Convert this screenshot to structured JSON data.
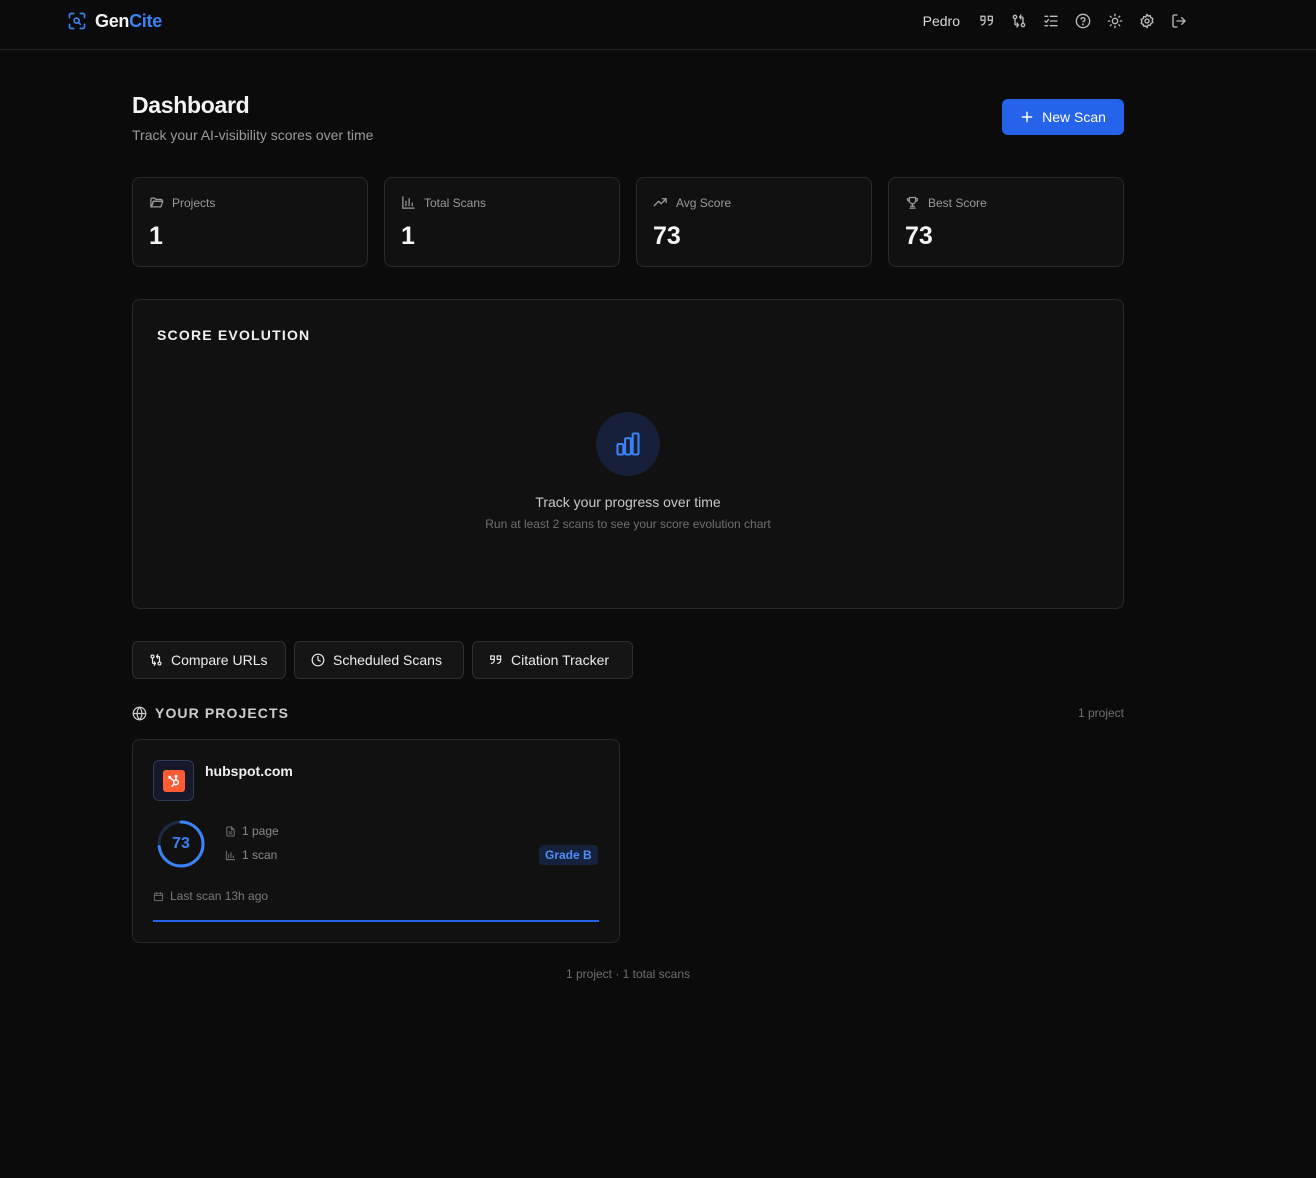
{
  "brand": {
    "part1": "Gen",
    "part2": "Cite"
  },
  "nav": {
    "user": "Pedro",
    "icons": [
      "quote-icon",
      "compare-icon",
      "checklist-icon",
      "help-icon",
      "sun-icon",
      "settings-icon",
      "logout-icon"
    ]
  },
  "header": {
    "title": "Dashboard",
    "subtitle": "Track your AI-visibility scores over time",
    "new_scan_label": "New Scan"
  },
  "stats": [
    {
      "label": "Projects",
      "value": "1",
      "icon": "folder-icon"
    },
    {
      "label": "Total Scans",
      "value": "1",
      "icon": "bar-chart-icon"
    },
    {
      "label": "Avg Score",
      "value": "73",
      "icon": "trending-up-icon"
    },
    {
      "label": "Best Score",
      "value": "73",
      "icon": "trophy-icon"
    }
  ],
  "evolution": {
    "title": "SCORE EVOLUTION",
    "empty_title": "Track your progress over time",
    "empty_subtitle": "Run at least 2 scans to see your score evolution chart"
  },
  "tools": [
    {
      "label": "Compare URLs",
      "icon": "compare-icon"
    },
    {
      "label": "Scheduled Scans",
      "icon": "clock-icon"
    },
    {
      "label": "Citation Tracker",
      "icon": "quote-icon"
    }
  ],
  "projects": {
    "heading": "YOUR PROJECTS",
    "count_label": "1 project",
    "items": [
      {
        "domain": "hubspot.com",
        "score": "73",
        "score_fraction": 0.73,
        "pages": "1 page",
        "scans": "1 scan",
        "grade": "Grade B",
        "last_scan": "Last scan 13h ago",
        "progress_fraction": 1.0
      }
    ]
  },
  "footer": "1 project · 1 total scans",
  "colors": {
    "accent": "#2563eb",
    "accent_text": "#3b82f6",
    "hubspot": "#ff5c35",
    "background": "#0b0b0b",
    "card": "#111111"
  }
}
